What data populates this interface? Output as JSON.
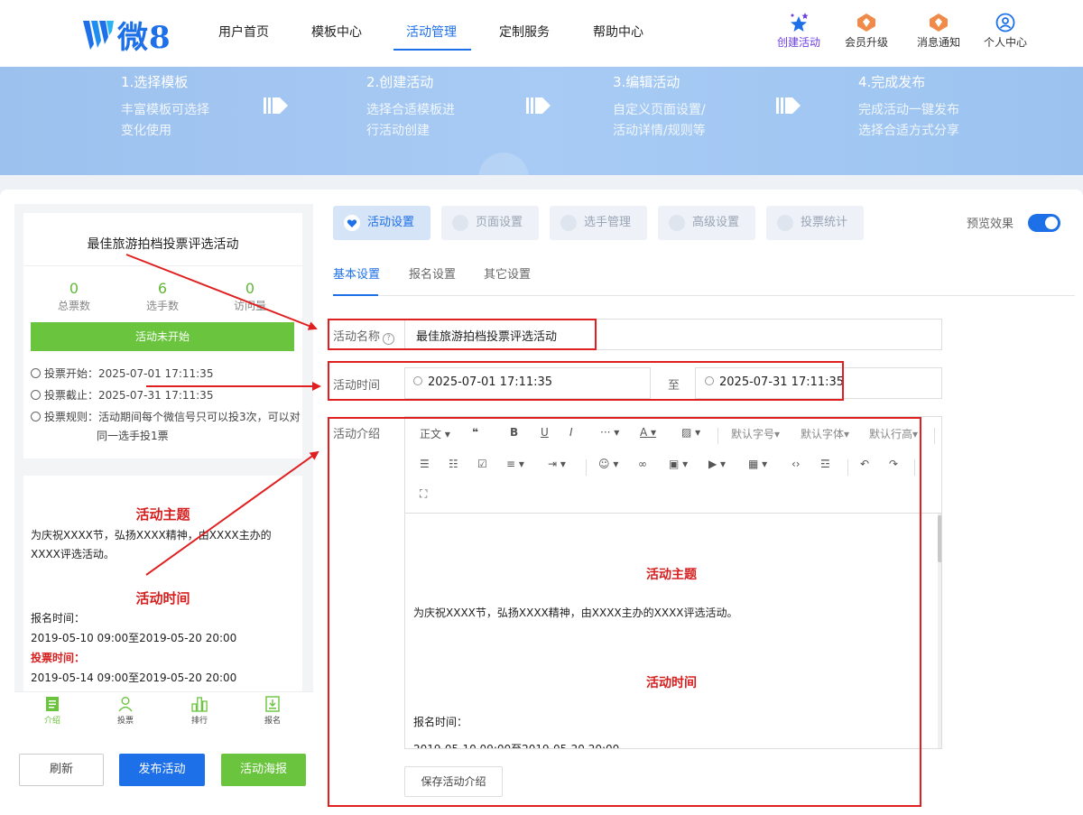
{
  "nav": {
    "logo_text": "微8",
    "items": [
      {
        "label": "用户首页"
      },
      {
        "label": "模板中心"
      },
      {
        "label": "活动管理"
      },
      {
        "label": "定制服务"
      },
      {
        "label": "帮助中心"
      }
    ],
    "quick": [
      {
        "label": "创建活动",
        "icon": "stars-icon"
      },
      {
        "label": "会员升级",
        "icon": "member-badge-icon"
      },
      {
        "label": "消息通知",
        "icon": "notification-badge-icon"
      },
      {
        "label": "个人中心",
        "icon": "user-icon"
      }
    ]
  },
  "banner": {
    "steps": [
      {
        "title": "1.选择模板",
        "line1": "丰富模板可选择",
        "line2": "变化使用"
      },
      {
        "title": "2.创建活动",
        "line1": "选择合适模板进",
        "line2": "行活动创建"
      },
      {
        "title": "3.编辑活动",
        "line1": "自定义页面设置/",
        "line2": "活动详情/规则等"
      },
      {
        "title": "4.完成发布",
        "line1": "完成活动一键发布",
        "line2": "选择合适方式分享"
      }
    ]
  },
  "preview": {
    "title": "最佳旅游拍档投票评选活动",
    "stats": [
      {
        "value": "0",
        "label": "总票数"
      },
      {
        "value": "6",
        "label": "选手数"
      },
      {
        "value": "0",
        "label": "访问量"
      }
    ],
    "status": "活动未开始",
    "vote_start": "投票开始：2025-07-01 17:11:35",
    "vote_end": "投票截止：2025-07-31 17:11:35",
    "rule_line1": "投票规则：活动期间每个微信号只可以投3次，可以对",
    "rule_line2": "同一选手投1票",
    "content": {
      "theme_title": "活动主题",
      "theme_text": "为庆祝XXXX节，弘扬XXXX精神，由XXXX主办的XXXX评选活动。",
      "time_title": "活动时间",
      "signup_label": "报名时间：",
      "signup_range": "2019-05-10 09:00至2019-05-20 20:00",
      "vote_label": "投票时间：",
      "vote_range": "2019-05-14 09:00至2019-05-20 20:00"
    },
    "tabs": [
      {
        "label": "介绍",
        "icon": "document-icon"
      },
      {
        "label": "投票",
        "icon": "person-icon"
      },
      {
        "label": "排行",
        "icon": "bar-chart-icon"
      },
      {
        "label": "报名",
        "icon": "signup-icon"
      }
    ]
  },
  "actions": {
    "refresh": "刷新",
    "publish": "发布活动",
    "poster": "活动海报"
  },
  "editor": {
    "main_tabs": [
      {
        "label": "活动设置"
      },
      {
        "label": "页面设置"
      },
      {
        "label": "选手管理"
      },
      {
        "label": "高级设置"
      },
      {
        "label": "投票统计"
      }
    ],
    "preview_label": "预览效果",
    "preview_on": true,
    "sub_tabs": [
      {
        "label": "基本设置"
      },
      {
        "label": "报名设置"
      },
      {
        "label": "其它设置"
      }
    ],
    "name_label": "活动名称",
    "name_value": "最佳旅游拍档投票评选活动",
    "time_label": "活动时间",
    "start_time": "2025-07-01 17:11:35",
    "to_label": "至",
    "end_time": "2025-07-31 17:11:35",
    "intro_label": "活动介绍",
    "toolbar": {
      "paragraph": "正文",
      "font_size": "默认字号",
      "font_family": "默认字体",
      "line_height": "默认行高"
    },
    "body": {
      "theme_title": "活动主题",
      "theme_text": "为庆祝XXXX节，弘扬XXXX精神，由XXXX主办的XXXX评选活动。",
      "time_title": "活动时间",
      "signup_label": "报名时间：",
      "signup_range": "2019-05-10 09:00至2019-05-20 20:00"
    },
    "save_label": "保存活动介绍"
  },
  "colors": {
    "primary": "#1e70e8",
    "green": "#6ac43e",
    "annotation_red": "#e02020",
    "content_red": "#d71e1e"
  }
}
